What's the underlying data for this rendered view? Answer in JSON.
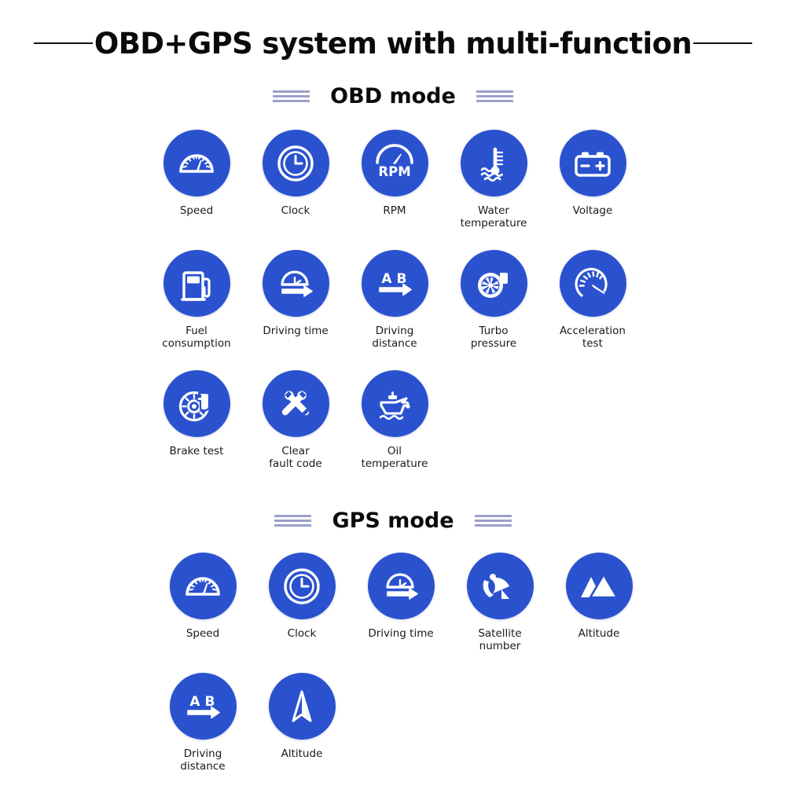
{
  "title": {
    "text": "OBD+GPS system with multi-function",
    "rule_color": "#111111"
  },
  "theme": {
    "icon_circle_color": "#2b52ce",
    "icon_glyph_color": "#ffffff",
    "section_line_color": "#9ba0cb",
    "label_color": "#1a1a1a",
    "background": "#ffffff"
  },
  "sections": [
    {
      "heading": "OBD mode",
      "rows": [
        {
          "items": [
            {
              "label": "Speed",
              "icon": "speedometer-icon"
            },
            {
              "label": "Clock",
              "icon": "clock-icon"
            },
            {
              "label": "RPM",
              "icon": "rpm-gauge-icon"
            },
            {
              "label": "Water\ntemperature",
              "icon": "water-temperature-icon"
            },
            {
              "label": "Voltage",
              "icon": "battery-icon"
            }
          ]
        },
        {
          "items": [
            {
              "label": "Fuel\nconsumption",
              "icon": "fuel-pump-icon"
            },
            {
              "label": "Driving time",
              "icon": "driving-time-icon"
            },
            {
              "label": "Driving\ndistance",
              "icon": "driving-distance-icon"
            },
            {
              "label": "Turbo\npressure",
              "icon": "turbo-icon"
            },
            {
              "label": "Acceleration\ntest",
              "icon": "acceleration-gauge-icon"
            }
          ]
        },
        {
          "items": [
            {
              "label": "Brake test",
              "icon": "brake-disc-icon"
            },
            {
              "label": "Clear\nfault code",
              "icon": "wrench-tools-icon"
            },
            {
              "label": "Oil\ntemperature",
              "icon": "oil-can-icon"
            }
          ]
        }
      ]
    },
    {
      "heading": "GPS mode",
      "rows": [
        {
          "items": [
            {
              "label": "Speed",
              "icon": "speedometer-icon"
            },
            {
              "label": "Clock",
              "icon": "clock-icon"
            },
            {
              "label": "Driving time",
              "icon": "driving-time-icon"
            },
            {
              "label": "Satellite\nnumber",
              "icon": "satellite-dish-icon"
            },
            {
              "label": "Altitude",
              "icon": "mountains-icon"
            }
          ]
        },
        {
          "items": [
            {
              "label": "Driving\ndistance",
              "icon": "driving-distance-icon"
            },
            {
              "label": "Altitude",
              "icon": "navigation-arrow-icon"
            }
          ]
        }
      ]
    }
  ]
}
